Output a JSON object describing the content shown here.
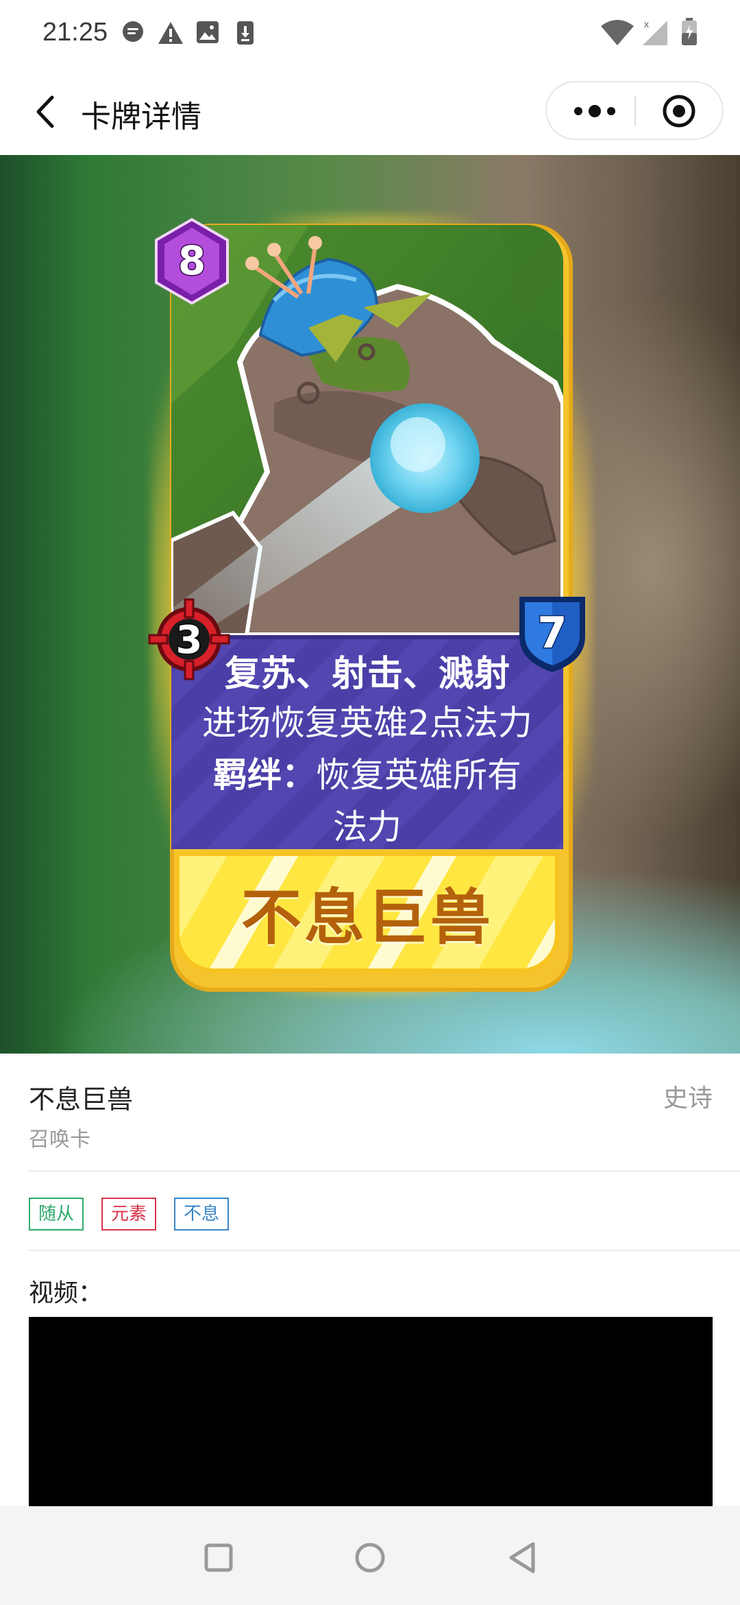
{
  "status_bar": {
    "time": "21:25",
    "left_icons": [
      "chat-bubble-icon",
      "warning-icon",
      "image-icon",
      "download-icon"
    ],
    "right_icons": [
      "wifi-icon",
      "signal-icon",
      "battery-icon"
    ]
  },
  "title_bar": {
    "title": "卡牌详情",
    "back_icon": "chevron-left-icon",
    "more_icon": "more-dots-icon",
    "close_icon": "target-circle-icon"
  },
  "card": {
    "cost": "8",
    "attack": "3",
    "health": "7",
    "ability_title": "复苏、射击、溅射",
    "ability_line_1": "进场恢复英雄2点法力",
    "bond_label": "羁绊：",
    "ability_line_2": "恢复英雄所有",
    "ability_line_3": "法力",
    "name": "不息巨兽",
    "colors": {
      "frame": "#f5c32d",
      "text_panel": "#4a3fa6",
      "name_text": "#b4610c",
      "cost_badge": "#9a35c6",
      "attack_badge": "#d8202a",
      "health_badge": "#1f5fc4"
    }
  },
  "info": {
    "title": "不息巨兽",
    "rarity": "史诗",
    "type": "召唤卡",
    "tags": [
      {
        "label": "随从",
        "color": "#2faa6a"
      },
      {
        "label": "元素",
        "color": "#d9344a"
      },
      {
        "label": "不息",
        "color": "#3a85c6"
      }
    ],
    "video_label": "视频："
  },
  "nav_bar": {
    "icons": [
      "recent-apps-icon",
      "home-icon",
      "back-triangle-icon"
    ]
  }
}
